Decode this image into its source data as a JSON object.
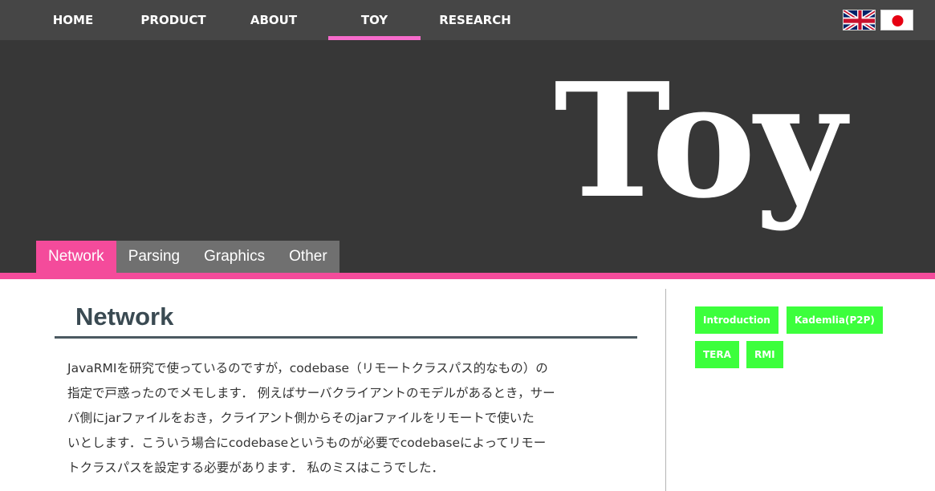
{
  "nav": {
    "items": [
      {
        "label": "HOME"
      },
      {
        "label": "PRODUCT"
      },
      {
        "label": "ABOUT"
      },
      {
        "label": "TOY",
        "active": true
      },
      {
        "label": "RESEARCH"
      }
    ],
    "languages": [
      {
        "icon": "uk-flag-icon"
      },
      {
        "icon": "japan-flag-icon"
      }
    ],
    "accent_color": "#f66bcb"
  },
  "hero": {
    "title": "Toy",
    "tabs": [
      {
        "label": "Network",
        "active": true
      },
      {
        "label": "Parsing"
      },
      {
        "label": "Graphics"
      },
      {
        "label": "Other"
      }
    ],
    "accent_color": "#f44b9b"
  },
  "main": {
    "title": "Network",
    "lines": [
      "JavaRMIを研究で使っているのですが，codebase（リモートクラスパス的なもの）の",
      "指定で戸惑ったのでメモします． 例えばサーバクライアントのモデルがあるとき，サー",
      "バ側にjarファイルをおき，クライアント側からそのjarファイルをリモートで使いた",
      "いとします．こういう場合にcodebaseというものが必要でcodebaseによってリモー",
      "トクラスパスを設定する必要があります． 私のミスはこうでした．"
    ]
  },
  "sidebar": {
    "tags": [
      {
        "label": "Introduction"
      },
      {
        "label": "Kademlia(P2P)"
      },
      {
        "label": "TERA"
      },
      {
        "label": "RMI"
      }
    ],
    "tag_color": "#3cff3c"
  }
}
